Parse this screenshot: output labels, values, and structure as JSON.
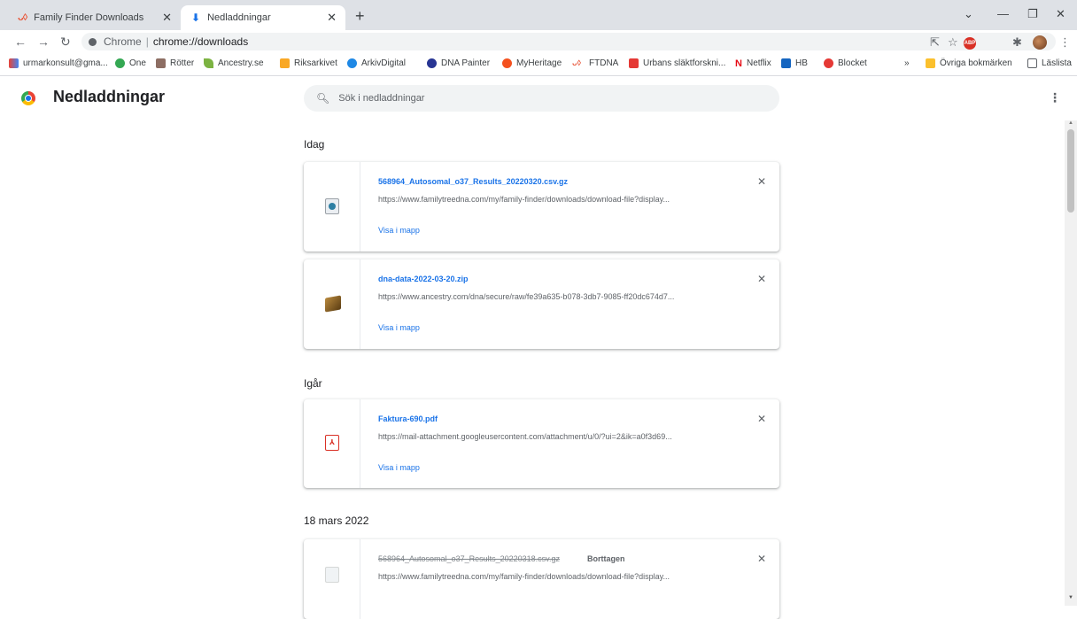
{
  "tabs": [
    {
      "title": "Family Finder Downloads",
      "active": false
    },
    {
      "title": "Nedladdningar",
      "active": true
    }
  ],
  "address_bar": {
    "scheme": "Chrome",
    "url": "chrome://downloads"
  },
  "bookmarks": [
    {
      "label": "urmarkonsult@gma...",
      "icon": "gmail-icon"
    },
    {
      "label": "One",
      "icon": "circle-icon"
    },
    {
      "label": "Rötter",
      "icon": "rotter-icon"
    },
    {
      "label": "Ancestry.se",
      "icon": "leaf-icon"
    },
    {
      "label": "Riksarkivet",
      "icon": "archive-icon"
    },
    {
      "label": "ArkivDigital",
      "icon": "arkiv-icon"
    },
    {
      "label": "DNA Painter",
      "icon": "dna-painter-icon"
    },
    {
      "label": "MyHeritage",
      "icon": "myheritage-icon"
    },
    {
      "label": "FTDNA",
      "icon": "ftdna-icon"
    },
    {
      "label": "Urbans släktforskni...",
      "icon": "urbans-icon"
    },
    {
      "label": "Netflix",
      "icon": "netflix-icon"
    },
    {
      "label": "HB",
      "icon": "hb-icon"
    },
    {
      "label": "Blocket",
      "icon": "blocket-icon"
    }
  ],
  "bookmarks_right": {
    "overflow": "»",
    "other": "Övriga bokmärken",
    "reading_list": "Läslista"
  },
  "page": {
    "title": "Nedladdningar",
    "search_placeholder": "Sök i nedladdningar"
  },
  "groups": [
    {
      "date": "Idag",
      "items": [
        {
          "name": "568964_Autosomal_o37_Results_20220320.csv.gz",
          "url": "https://www.familytreedna.com/my/family-finder/downloads/download-file?display...",
          "action": "Visa i mapp",
          "status": ""
        },
        {
          "name": "dna-data-2022-03-20.zip",
          "url": "https://www.ancestry.com/dna/secure/raw/fe39a635-b078-3db7-9085-ff20dc674d7...",
          "action": "Visa i mapp",
          "status": ""
        }
      ]
    },
    {
      "date": "Igår",
      "items": [
        {
          "name": "Faktura-690.pdf",
          "url": "https://mail-attachment.googleusercontent.com/attachment/u/0/?ui=2&ik=a0f3d69...",
          "action": "Visa i mapp",
          "status": ""
        }
      ]
    },
    {
      "date": "18 mars 2022",
      "items": [
        {
          "name": "568964_Autosomal_o37_Results_20220318.csv.gz",
          "url": "https://www.familytreedna.com/my/family-finder/downloads/download-file?display...",
          "action": "",
          "status": "Borttagen"
        }
      ]
    }
  ]
}
